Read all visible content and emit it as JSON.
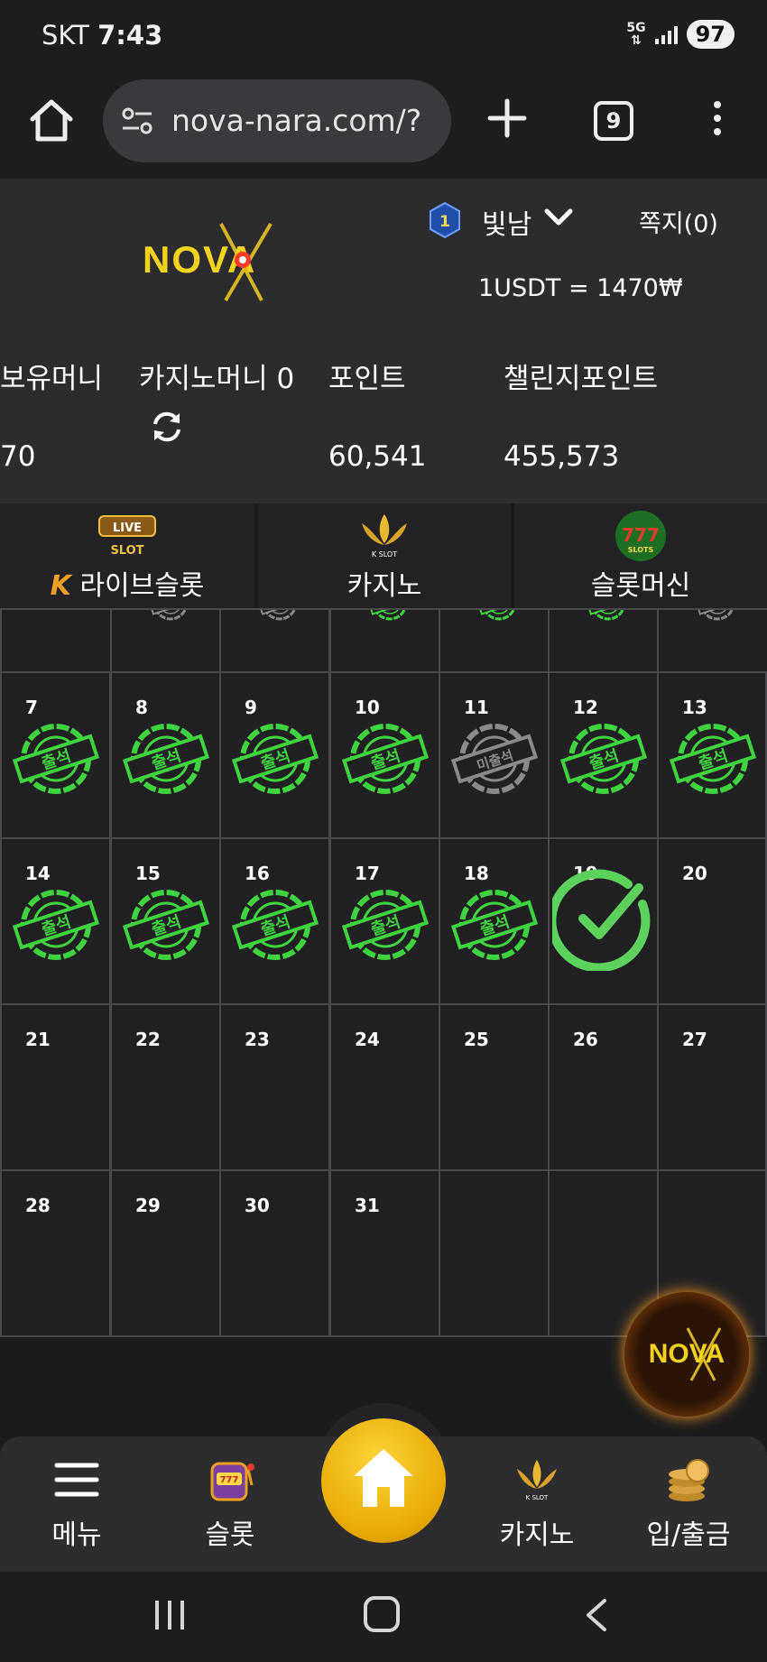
{
  "status_bar": {
    "carrier": "SKT",
    "time": "7:43",
    "network": "5G",
    "battery": "97"
  },
  "browser": {
    "url": "nova-nara.com/?",
    "tab_count": "9"
  },
  "header": {
    "logo_text": "NOVA",
    "rank": "1",
    "username": "빛남",
    "messages": "쪽지(0)",
    "rate": "1USDT = 1470₩"
  },
  "balances": {
    "holding_label": "보유머니",
    "holding_value": "70",
    "casino_label": "카지노머니 0",
    "points_label": "포인트",
    "points_value": "60,541",
    "challenge_label": "챌린지포인트",
    "challenge_value": "455,573"
  },
  "categories": [
    {
      "label": "라이브슬롯",
      "icon": "live-slot-icon",
      "badge": "K"
    },
    {
      "label": "카지노",
      "icon": "k-slot-icon"
    },
    {
      "label": "슬롯머신",
      "icon": "777-slots-icon"
    }
  ],
  "stamps": {
    "present": "출석",
    "absent": "미출석"
  },
  "calendar": {
    "top_row_status": [
      "absent",
      "absent",
      "present",
      "present",
      "present",
      "absent"
    ],
    "weeks": [
      [
        {
          "day": "7",
          "status": "present"
        },
        {
          "day": "8",
          "status": "present"
        },
        {
          "day": "9",
          "status": "present"
        },
        {
          "day": "10",
          "status": "present"
        },
        {
          "day": "11",
          "status": "absent"
        },
        {
          "day": "12",
          "status": "present"
        },
        {
          "day": "13",
          "status": "present"
        }
      ],
      [
        {
          "day": "14",
          "status": "present"
        },
        {
          "day": "15",
          "status": "present"
        },
        {
          "day": "16",
          "status": "present"
        },
        {
          "day": "17",
          "status": "present"
        },
        {
          "day": "18",
          "status": "present"
        },
        {
          "day": "19",
          "status": "today"
        },
        {
          "day": "20",
          "status": ""
        }
      ],
      [
        {
          "day": "21",
          "status": ""
        },
        {
          "day": "22",
          "status": ""
        },
        {
          "day": "23",
          "status": ""
        },
        {
          "day": "24",
          "status": ""
        },
        {
          "day": "25",
          "status": ""
        },
        {
          "day": "26",
          "status": ""
        },
        {
          "day": "27",
          "status": ""
        }
      ],
      [
        {
          "day": "28",
          "status": ""
        },
        {
          "day": "29",
          "status": ""
        },
        {
          "day": "30",
          "status": ""
        },
        {
          "day": "31",
          "status": ""
        },
        {
          "day": "",
          "status": ""
        },
        {
          "day": "",
          "status": ""
        },
        {
          "day": "",
          "status": ""
        }
      ]
    ]
  },
  "bottom_nav": {
    "menu": "메뉴",
    "slot": "슬롯",
    "casino": "카지노",
    "deposit": "입/출금"
  },
  "colors": {
    "stamp_green": "#3fd43f",
    "stamp_gray": "#8a8a8a",
    "accent_gold": "#e6b800",
    "check_green": "#5cd25c"
  }
}
